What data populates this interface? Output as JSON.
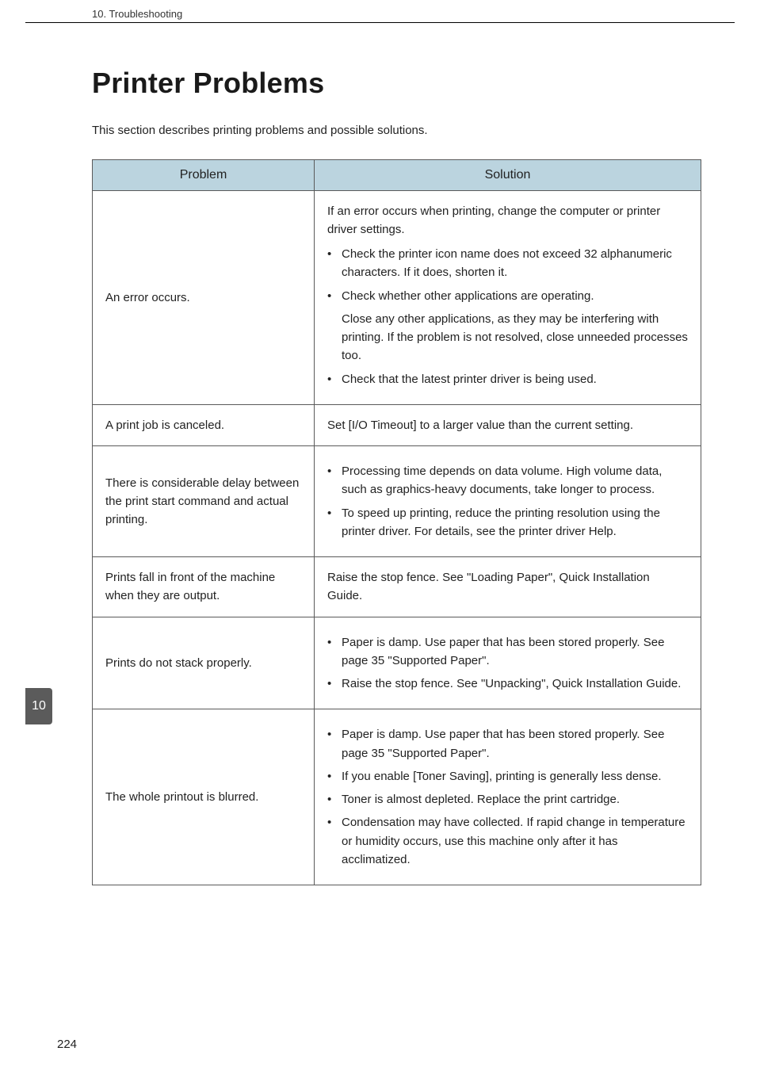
{
  "header": {
    "running_title": "10. Troubleshooting"
  },
  "title": "Printer Problems",
  "intro": "This section describes printing problems and possible solutions.",
  "table": {
    "head": {
      "problem": "Problem",
      "solution": "Solution"
    },
    "rows": [
      {
        "problem": "An error occurs.",
        "lead": "If an error occurs when printing, change the computer or printer driver settings.",
        "bullets": [
          "Check the printer icon name does not exceed 32 alphanumeric characters. If it does, shorten it.",
          "Check whether other applications are operating.",
          "Check that the latest printer driver is being used."
        ],
        "sub_after_bullet_index": 1,
        "sub": "Close any other applications, as they may be interfering with printing. If the problem is not resolved, close unneeded processes too."
      },
      {
        "problem": "A print job is canceled.",
        "lead": "Set [I/O Timeout] to a larger value than the current setting."
      },
      {
        "problem": "There is considerable delay between the print start command and actual printing.",
        "bullets": [
          "Processing time depends on data volume. High volume data, such as graphics-heavy documents, take longer to process.",
          "To speed up printing, reduce the printing resolution using the printer driver. For details, see the printer driver Help."
        ]
      },
      {
        "problem": "Prints fall in front of the machine when they are output.",
        "lead": "Raise the stop fence. See \"Loading Paper\", Quick Installation Guide."
      },
      {
        "problem": "Prints do not stack properly.",
        "bullets": [
          "Paper is damp. Use paper that has been stored properly. See page 35 \"Supported Paper\".",
          "Raise the stop fence. See \"Unpacking\", Quick Installation Guide."
        ]
      },
      {
        "problem": "The whole printout is blurred.",
        "bullets": [
          "Paper is damp. Use paper that has been stored properly. See page 35 \"Supported Paper\".",
          "If you enable [Toner Saving], printing is generally less dense.",
          "Toner is almost depleted. Replace the print cartridge.",
          "Condensation may have collected. If rapid change in temperature or humidity occurs, use this machine only after it has acclimatized."
        ]
      }
    ]
  },
  "side_tab": "10",
  "page_number": "224"
}
